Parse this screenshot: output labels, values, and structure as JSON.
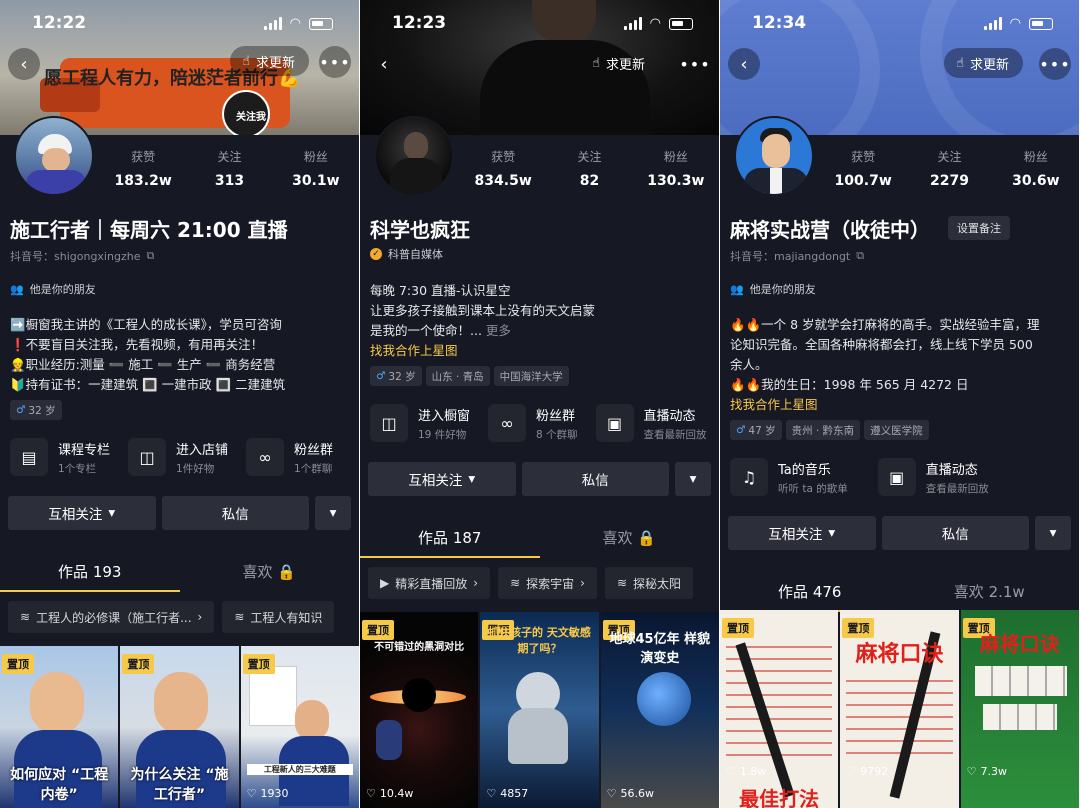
{
  "panels": [
    {
      "status_time": "12:22",
      "request_update": "求更新",
      "cover_banner": "愿工程人有力，陪迷茫者前行💪",
      "cover_follow_badge": "关注我",
      "stats": [
        {
          "label": "获赞",
          "value": "183.2w"
        },
        {
          "label": "关注",
          "value": "313"
        },
        {
          "label": "粉丝",
          "value": "30.1w"
        }
      ],
      "name": "施工行者｜每周六 21:00 直播",
      "account_id": "抖音号：shigongxingzhe",
      "friend_label": "他是你的朋友",
      "bio": [
        "➡️橱窗我主讲的《工程人的成长课》，学员可咨询",
        "❗不要盲目关注我，先看视频，有用再关注！",
        "👷职业经历:测量 ➖ 施工 ➖ 生产 ➖ 商务经营",
        "🔰持有证书：一建建筑 🔳 一建市政 🔳 二建建筑"
      ],
      "tags": [
        "32 岁"
      ],
      "services": [
        {
          "title": "课程专栏",
          "sub": "1个专栏",
          "icon": "document-icon"
        },
        {
          "title": "进入店铺",
          "sub": "1件好物",
          "icon": "shopping-bag-icon"
        },
        {
          "title": "粉丝群",
          "sub": "1个群聊",
          "icon": "group-chat-icon"
        }
      ],
      "follow_btn": "互相关注",
      "message_btn": "私信",
      "tab_works": "作品 193",
      "tab_likes": "喜欢",
      "chips": [
        "工程人的必修课（施工行者...",
        "工程人有知识"
      ],
      "thumbs": [
        {
          "pinned": "置顶",
          "caption": "如何应对 “工程内卷”",
          "likes": ""
        },
        {
          "pinned": "置顶",
          "caption": "为什么关注 “施工行者”",
          "likes": ""
        },
        {
          "pinned": "置顶",
          "caption": "工程新人的三大难题",
          "likes": "1930"
        }
      ]
    },
    {
      "status_time": "12:23",
      "request_update": "求更新",
      "stats": [
        {
          "label": "获赞",
          "value": "834.5w"
        },
        {
          "label": "关注",
          "value": "82"
        },
        {
          "label": "粉丝",
          "value": "130.3w"
        }
      ],
      "name": "科学也疯狂",
      "verify_label": "科普自媒体",
      "bio": [
        "每晚 7:30 直播-认识星空",
        "让更多孩子接触到课本上没有的天文启蒙",
        "是我的一个使命！..."
      ],
      "bio_more": "更多",
      "contact_link": "找我合作上星图",
      "tags": [
        "32 岁",
        "山东 · 青岛",
        "中国海洋大学"
      ],
      "services": [
        {
          "title": "进入橱窗",
          "sub": "19 件好物",
          "icon": "shopping-bag-icon"
        },
        {
          "title": "粉丝群",
          "sub": "8 个群聊",
          "icon": "group-chat-icon"
        },
        {
          "title": "直播动态",
          "sub": "查看最新回放",
          "icon": "tv-icon"
        }
      ],
      "follow_btn": "互相关注",
      "message_btn": "私信",
      "tab_works": "作品 187",
      "tab_likes": "喜欢",
      "chips": [
        "精彩直播回放",
        "探索宇宙",
        "探秘太阳"
      ],
      "thumbs": [
        {
          "pinned": "置顶",
          "caption": "不可错过的黑洞对比",
          "likes": "10.4w"
        },
        {
          "pinned": "置顶",
          "caption": "抓住孩子的 天文敏感期了吗？",
          "likes": "4857"
        },
        {
          "pinned": "置顶",
          "caption": "地球45亿年 样貌演变史",
          "likes": "56.6w"
        }
      ]
    },
    {
      "status_time": "12:34",
      "request_update": "求更新",
      "stats": [
        {
          "label": "获赞",
          "value": "100.7w"
        },
        {
          "label": "关注",
          "value": "2279"
        },
        {
          "label": "粉丝",
          "value": "30.6w"
        }
      ],
      "name": "麻将实战营（收徒中）",
      "remark_btn": "设置备注",
      "account_id": "抖音号：majiangdongt",
      "friend_label": "他是你的朋友",
      "bio": [
        "🔥🔥一个 8 岁就学会打麻将的高手。实战经验丰富，理",
        "论知识完备。全国各种麻将都会打，线上线下学员 500",
        "余人。",
        "🔥🔥我的生日：1998 年 565 月 4272 日"
      ],
      "contact_link": "找我合作上星图",
      "tags": [
        "47 岁",
        "贵州 · 黔东南",
        "遵义医学院"
      ],
      "services": [
        {
          "title": "Ta的音乐",
          "sub": "听听 ta 的歌单",
          "icon": "music-note-icon"
        },
        {
          "title": "直播动态",
          "sub": "查看最新回放",
          "icon": "tv-icon"
        }
      ],
      "follow_btn": "互相关注",
      "message_btn": "私信",
      "tab_works": "作品 476",
      "tab_likes": "喜欢 2.1w",
      "thumbs": [
        {
          "pinned": "置顶",
          "caption": "最佳打法",
          "likes": "1.8w"
        },
        {
          "pinned": "置顶",
          "caption": "麻将口诀",
          "likes": "9792"
        },
        {
          "pinned": "置顶",
          "caption": "麻将口诀",
          "likes": "7.3w"
        }
      ]
    }
  ]
}
